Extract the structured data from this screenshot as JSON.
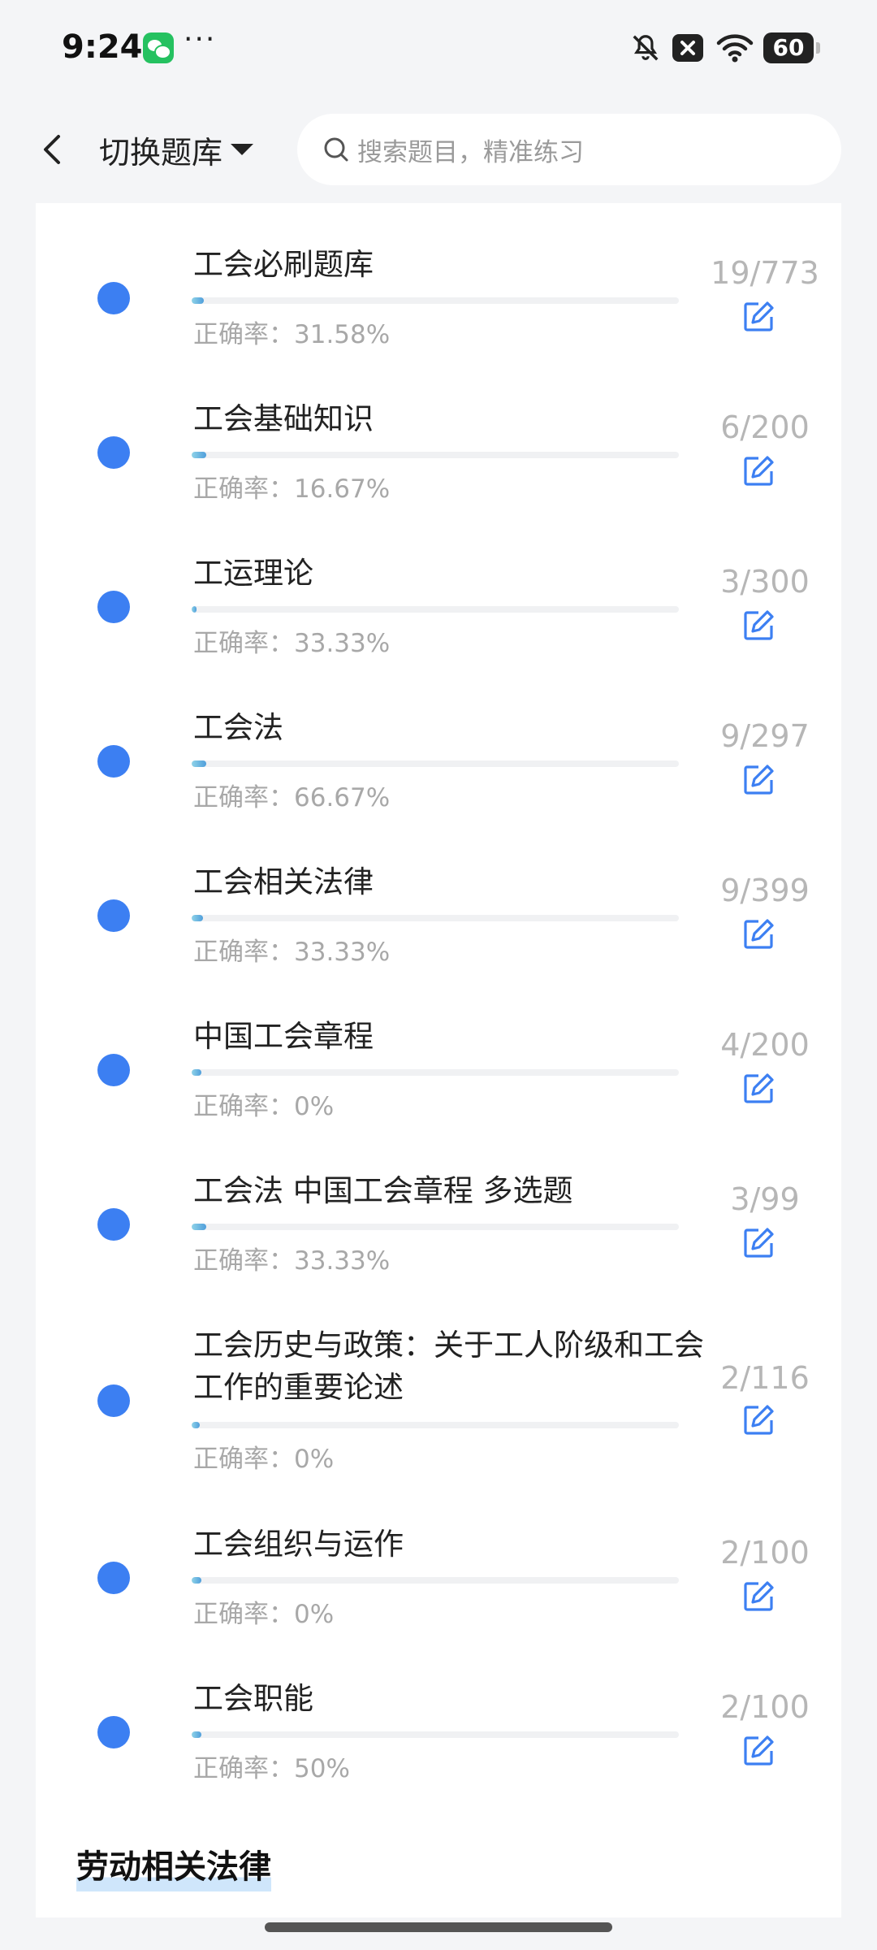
{
  "status_bar": {
    "time": "9:24",
    "more": "···",
    "battery": "60"
  },
  "header": {
    "switch_label": "切换题库",
    "search_placeholder": "搜索题目，精准练习"
  },
  "items": [
    {
      "title": "工会必刷题库",
      "accuracy": "正确率：31.58%",
      "count": "19/773",
      "progress": 0.025
    },
    {
      "title": "工会基础知识",
      "accuracy": "正确率：16.67%",
      "count": "6/200",
      "progress": 0.03
    },
    {
      "title": "工运理论",
      "accuracy": "正确率：33.33%",
      "count": "3/300",
      "progress": 0.01
    },
    {
      "title": "工会法",
      "accuracy": "正确率：66.67%",
      "count": "9/297",
      "progress": 0.03
    },
    {
      "title": "工会相关法律",
      "accuracy": "正确率：33.33%",
      "count": "9/399",
      "progress": 0.023
    },
    {
      "title": "中国工会章程",
      "accuracy": "正确率：0%",
      "count": "4/200",
      "progress": 0.02
    },
    {
      "title": "工会法 中国工会章程 多选题",
      "accuracy": "正确率：33.33%",
      "count": "3/99",
      "progress": 0.03
    },
    {
      "title": "工会历史与政策：关于工人阶级和工会工作的重要论述",
      "accuracy": "正确率：0%",
      "count": "2/116",
      "progress": 0.017
    },
    {
      "title": "工会组织与运作",
      "accuracy": "正确率：0%",
      "count": "2/100",
      "progress": 0.02
    },
    {
      "title": "工会职能",
      "accuracy": "正确率：50%",
      "count": "2/100",
      "progress": 0.02
    }
  ],
  "section_title": "劳动相关法律",
  "colors": {
    "accent": "#3c7ff2",
    "progress_start": "#8fd3e8",
    "progress_end": "#4f9edb",
    "muted_text": "#a8a8a8",
    "count_text": "#b6b6b6"
  }
}
